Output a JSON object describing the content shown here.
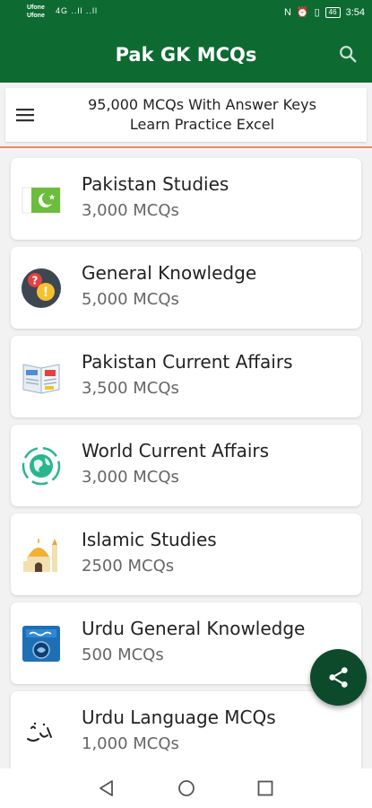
{
  "status_bar": {
    "carrier_1": "Ufone",
    "carrier_2": "Ufone",
    "signal_text": "4G ..ll ..ll",
    "battery": "46",
    "time": "3:54"
  },
  "app_bar": {
    "title": "Pak GK MCQs",
    "search_icon": "search-icon"
  },
  "banner": {
    "line_1": "95,000 MCQs With Answer Keys",
    "line_2": "Learn Practice Excel",
    "menu_icon": "hamburger-menu-icon"
  },
  "categories": [
    {
      "title": "Pakistan Studies",
      "count": "3,000 MCQs",
      "icon": "pakistan-flag-icon"
    },
    {
      "title": "General Knowledge",
      "count": "5,000 MCQs",
      "icon": "question-exclamation-icon"
    },
    {
      "title": "Pakistan Current Affairs",
      "count": "3,500 MCQs",
      "icon": "newspaper-icon"
    },
    {
      "title": "World Current Affairs",
      "count": "3,000 MCQs",
      "icon": "globe-icon"
    },
    {
      "title": "Islamic Studies",
      "count": "2500 MCQs",
      "icon": "mosque-icon"
    },
    {
      "title": "Urdu General Knowledge",
      "count": "500 MCQs",
      "icon": "urdu-book-icon"
    },
    {
      "title": "Urdu Language MCQs",
      "count": "1,000 MCQs",
      "icon": "urdu-calligraphy-icon"
    }
  ],
  "fab": {
    "icon": "share-icon"
  },
  "nav": {
    "back_icon": "back-triangle-icon",
    "home_icon": "home-circle-icon",
    "recents_icon": "recents-square-icon"
  },
  "colors": {
    "primary": "#0d6b32",
    "fab": "#0d4a2c",
    "accent_line": "#f08a5d",
    "background": "#f2f2f2"
  }
}
